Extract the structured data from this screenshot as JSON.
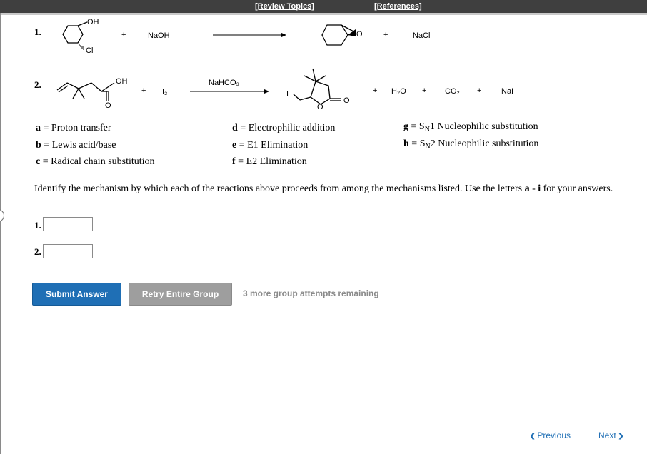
{
  "toolbar": {
    "review_topics": "[Review Topics]",
    "references": "[References]"
  },
  "reaction1": {
    "number": "1.",
    "reactant_oh": "OH",
    "reactant_cl": "Cl",
    "plus1": "+",
    "reagent": "NaOH",
    "product_o": "O",
    "plus2": "+",
    "byproduct": "NaCl"
  },
  "reaction2": {
    "number": "2.",
    "reactant_oh": "OH",
    "reactant_o": "O",
    "plus1": "+",
    "reagent": "I₂",
    "condition": "NaHCO₃",
    "product_i": "I",
    "product_o_ring": "O",
    "product_o_carbonyl": "O",
    "plus2": "+",
    "water": "H₂O",
    "plus3": "+",
    "co2": "CO₂",
    "plus4": "+",
    "nai": "NaI"
  },
  "mechanisms": [
    {
      "letter": "a",
      "eq": " = ",
      "text": "Proton transfer"
    },
    {
      "letter": "b",
      "eq": " = ",
      "text": "Lewis acid/base"
    },
    {
      "letter": "c",
      "eq": " = ",
      "text": "Radical chain substitution"
    },
    {
      "letter": "d",
      "eq": " = ",
      "text": "Electrophilic addition"
    },
    {
      "letter": "e",
      "eq": " = ",
      "text": "E1 Elimination"
    },
    {
      "letter": "f",
      "eq": " = ",
      "text": "E2 Elimination"
    },
    {
      "letter": "g",
      "eq": " = S",
      "sub": "N",
      "text": "1 Nucleophilic substitution"
    },
    {
      "letter": "h",
      "eq": " = S",
      "sub": "N",
      "text": "2 Nucleophilic substitution"
    }
  ],
  "instructions": {
    "text": "Identify the mechanism by which each of the reactions above proceeds from among the mechanisms listed. Use the letters ",
    "range_a": "a",
    "range_sep": " - ",
    "range_i": "i",
    "text_end": " for your answers."
  },
  "answers": [
    {
      "label": "1.",
      "value": "",
      "placeholder": ""
    },
    {
      "label": "2.",
      "value": "",
      "placeholder": ""
    }
  ],
  "buttons": {
    "submit": "Submit Answer",
    "retry": "Retry Entire Group",
    "attempts": "3 more group attempts remaining"
  },
  "nav": {
    "previous": "Previous",
    "next": "Next"
  },
  "colors": {
    "primary": "#1f6fb5",
    "secondary": "#9e9e9e",
    "attempts_text": "#8a8a8a",
    "header": "#3f3f3f"
  }
}
